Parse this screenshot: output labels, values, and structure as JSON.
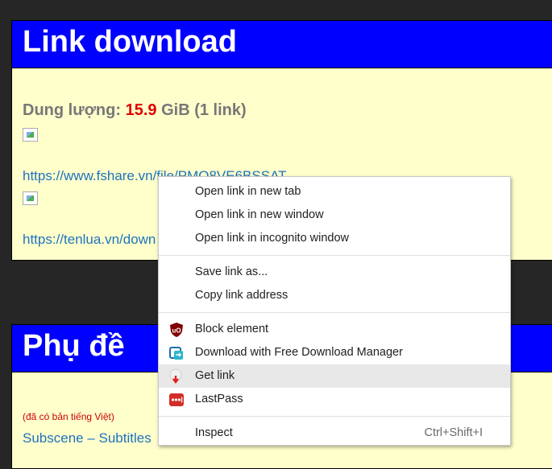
{
  "section1": {
    "header": "Link download",
    "size_label": "Dung lượng:",
    "size_value": "15.9",
    "size_unit": "GiB (1 link)",
    "link1": "https://www.fshare.vn/file/PMO8VE6BSSAT",
    "link2": "https://tenlua.vn/down"
  },
  "section2": {
    "header": "Phụ đề",
    "note": "(đã có bản tiếng Việt)",
    "link": "Subscene – Subtitles"
  },
  "context_menu": {
    "items": [
      {
        "label": "Open link in new tab"
      },
      {
        "label": "Open link in new window"
      },
      {
        "label": "Open link in incognito window"
      },
      {
        "label": "Save link as..."
      },
      {
        "label": "Copy link address"
      },
      {
        "label": "Block element",
        "icon": "ublock-icon"
      },
      {
        "label": "Download with Free Download Manager",
        "icon": "fdm-icon"
      },
      {
        "label": "Get link",
        "icon": "get-link-icon"
      },
      {
        "label": "LastPass",
        "icon": "lastpass-icon"
      },
      {
        "label": "Inspect",
        "shortcut": "Ctrl+Shift+I"
      }
    ],
    "highlighted_item": "Get link"
  },
  "colors": {
    "header_bg": "#0000ff",
    "content_bg": "#ffffcc",
    "page_bg": "#262626",
    "link": "#1e73be",
    "size_value": "#e00000"
  }
}
